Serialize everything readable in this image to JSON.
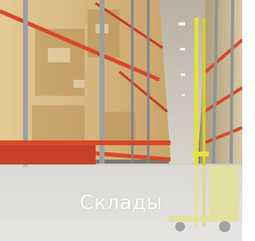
{
  "tile": {
    "caption": "Склады"
  },
  "colors": {
    "rack_orange": "#d8492a",
    "forklift_yellow": "#e6e03a",
    "caption_band": "#e1e1e1",
    "caption_text": "#ffffff"
  }
}
